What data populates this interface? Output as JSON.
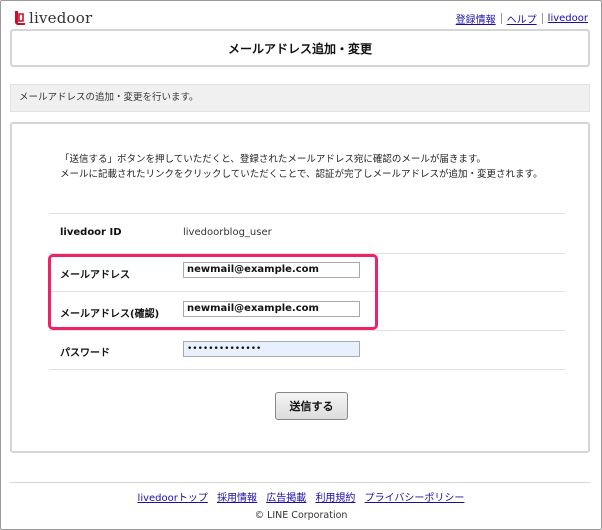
{
  "header": {
    "logo_text": "livedoor",
    "links": [
      "登録情報",
      "ヘルプ",
      "livedoor"
    ]
  },
  "page": {
    "title": "メールアドレス追加・変更",
    "description": "メールアドレスの追加・変更を行います。"
  },
  "intro": {
    "line1": "「送信する」ボタンを押していただくと、登録されたメールアドレス宛に確認のメールが届きます。",
    "line2": "メールに記載されたリンクをクリックしていただくことで、認証が完了しメールアドレスが追加・変更されます。"
  },
  "form": {
    "id_label": "livedoor ID",
    "id_value": "livedoorblog_user",
    "email_label": "メールアドレス",
    "email_value": "newmail@example.com",
    "email_confirm_label": "メールアドレス(確認)",
    "email_confirm_value": "newmail@example.com",
    "password_label": "パスワード",
    "password_value": "••••••••••••••",
    "submit_label": "送信する"
  },
  "footer": {
    "links": [
      "livedoorトップ",
      "採用情報",
      "広告掲載",
      "利用規約",
      "プライバシーポリシー"
    ],
    "copyright": "© LINE Corporation"
  },
  "colors": {
    "highlight": "#ee2367",
    "link": "#1a0dab",
    "logo_red": "#c8102e"
  }
}
